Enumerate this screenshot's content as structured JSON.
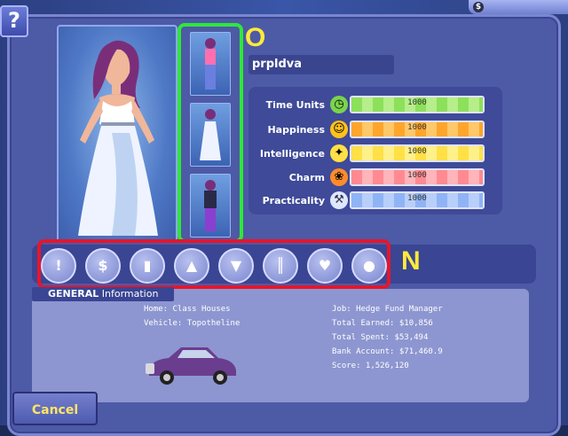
{
  "character": {
    "name": "prpldva"
  },
  "stats": [
    {
      "label": "Time Units",
      "value": "1000",
      "icon": "clock-icon",
      "color": "#8de05a",
      "icon_color": "#7bd34c"
    },
    {
      "label": "Happiness",
      "value": "1000",
      "icon": "smiley-icon",
      "color": "#ffa52b",
      "icon_color": "#ffc21a"
    },
    {
      "label": "Intelligence",
      "value": "1000",
      "icon": "lightbulb-icon",
      "color": "#ffe046",
      "icon_color": "#ffe046"
    },
    {
      "label": "Charm",
      "value": "1000",
      "icon": "flower-icon",
      "color": "#ff8a92",
      "icon_color": "#ff8c2a"
    },
    {
      "label": "Practicality",
      "value": "1000",
      "icon": "saw-icon",
      "color": "#8fb4f5",
      "icon_color": "#dfe7ff"
    }
  ],
  "tabs": [
    {
      "icon": "exclamation-icon",
      "glyph": "!"
    },
    {
      "icon": "money-icon",
      "glyph": "$"
    },
    {
      "icon": "book-icon",
      "glyph": "▮"
    },
    {
      "icon": "graduation-cap-icon",
      "glyph": "▲"
    },
    {
      "icon": "shirt-icon",
      "glyph": "▼"
    },
    {
      "icon": "wardrobe-icon",
      "glyph": "║"
    },
    {
      "icon": "heart-icon",
      "glyph": "♥"
    },
    {
      "icon": "pet-icon",
      "glyph": "●"
    }
  ],
  "annotations": {
    "outfit_marker": "O",
    "tabs_marker": "N"
  },
  "info": {
    "header_bold": "GENERAL",
    "header_rest": " Information",
    "home": "Home: Class Houses",
    "vehicle": "Vehicle: Topotheline",
    "job": "Job: Hedge Fund Manager",
    "earned": "Total Earned: $10,856",
    "spent": "Total Spent: $53,494",
    "bank": "Bank Account: $71,460.9",
    "score": "Score: 1,526,120"
  },
  "help_label": "?",
  "money_symbol": "$",
  "cancel_label": "Cancel"
}
